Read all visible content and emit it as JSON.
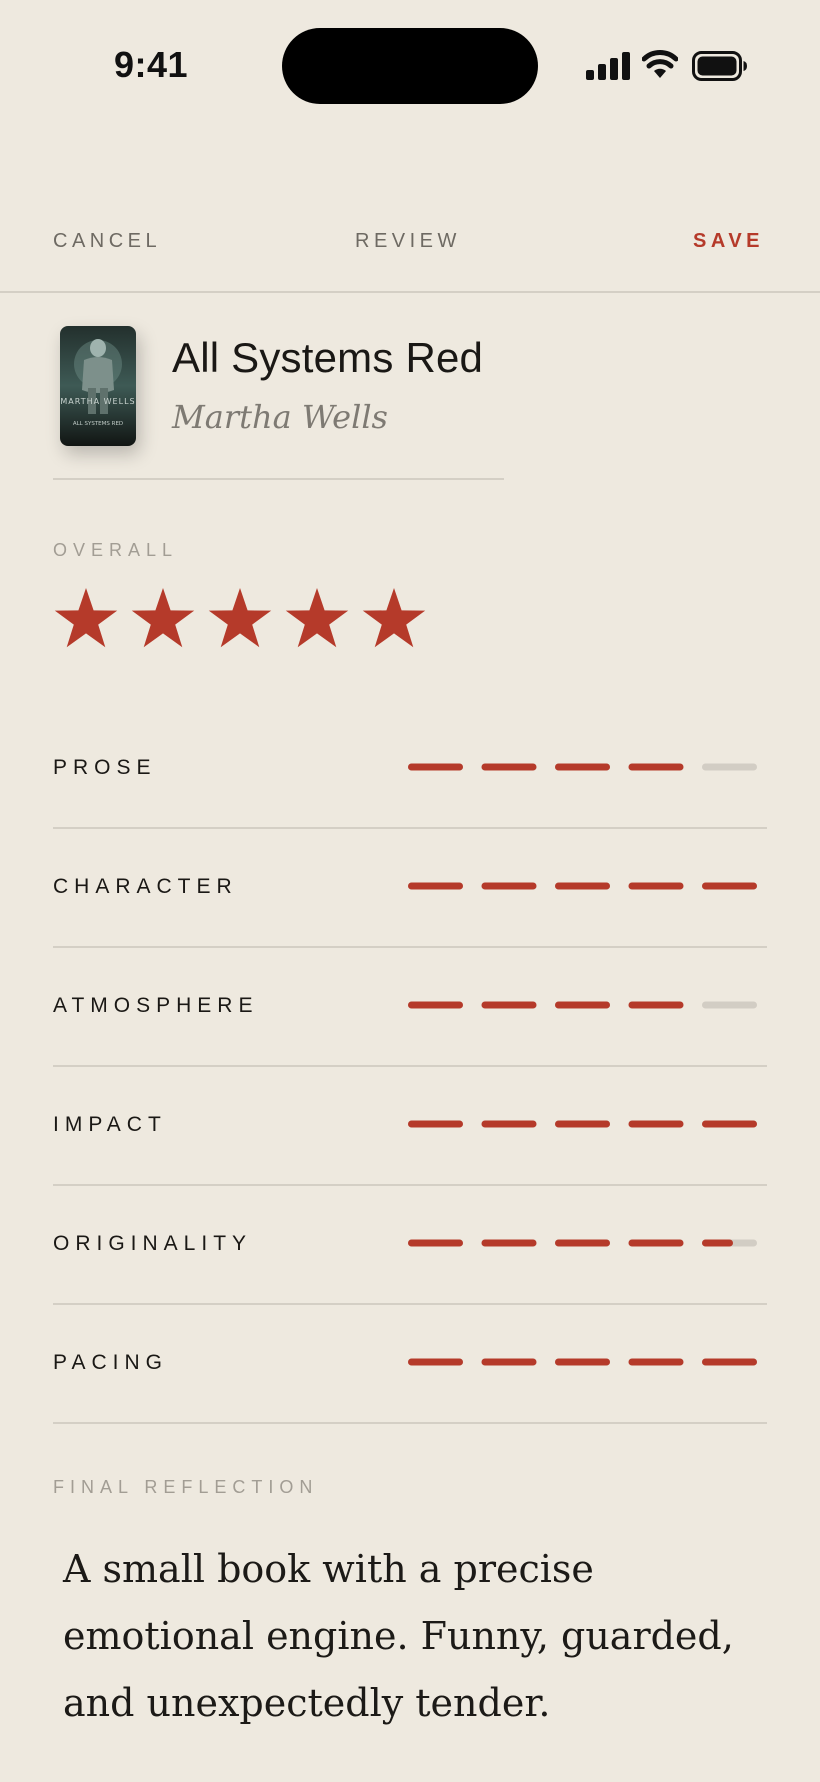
{
  "status_bar": {
    "time": "9:41"
  },
  "nav": {
    "cancel": "CANCEL",
    "title": "REVIEW",
    "save": "SAVE"
  },
  "book": {
    "title": "All Systems Red",
    "author": "Martha Wells",
    "cover": {
      "author": "MARTHA WELLS",
      "title": "ALL SYSTEMS RED"
    }
  },
  "overall": {
    "label": "OVERALL",
    "rating": 5,
    "max": 5
  },
  "ratings": [
    {
      "label": "PROSE",
      "value": 4.0,
      "max": 5
    },
    {
      "label": "CHARACTER",
      "value": 5.0,
      "max": 5
    },
    {
      "label": "ATMOSPHERE",
      "value": 4.0,
      "max": 5
    },
    {
      "label": "IMPACT",
      "value": 5.0,
      "max": 5
    },
    {
      "label": "ORIGINALITY",
      "value": 4.5,
      "max": 5
    },
    {
      "label": "PACING",
      "value": 5.0,
      "max": 5
    }
  ],
  "reflection": {
    "label": "FINAL REFLECTION",
    "text": "A small book with a precise emotional engine. Funny, guarded, and unexpectedly tender."
  },
  "colors": {
    "accent": "#B53A2A",
    "track": "#D2CDC4",
    "background": "#EEE9DF",
    "divider": "#D4CFC5"
  }
}
